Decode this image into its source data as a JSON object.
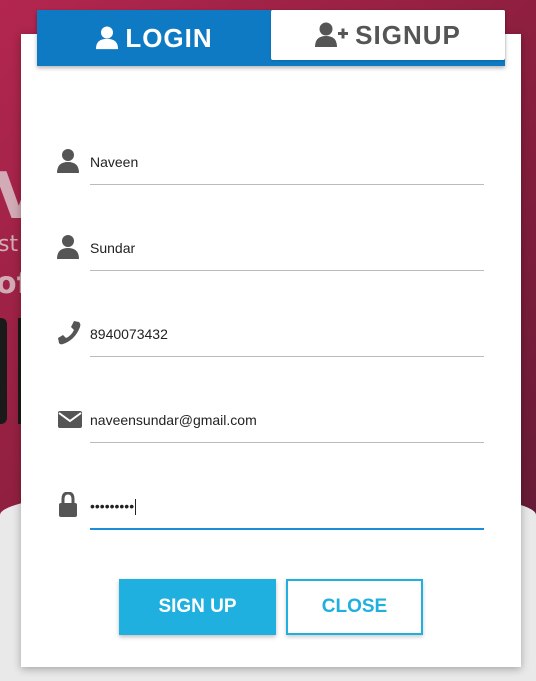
{
  "background": {
    "fragment_v": "V",
    "fragment_st": "st",
    "fragment_of": "of"
  },
  "tabs": {
    "login_label": "LOGIN",
    "signup_label": "SIGNUP"
  },
  "form": {
    "first_name": "Naveen",
    "last_name": "Sundar",
    "phone": "8940073432",
    "email": "naveensundar@gmail.com",
    "password_masked": "•••••••••"
  },
  "buttons": {
    "signup": "SIGN UP",
    "close": "CLOSE"
  },
  "colors": {
    "accent_blue": "#0e7ac4",
    "button_cyan": "#1fb0e0",
    "background": "#b3264f"
  },
  "icons": {
    "login_tab": "user-icon",
    "signup_tab": "user-plus-icon",
    "first_name": "user-icon",
    "last_name": "user-icon",
    "phone": "phone-icon",
    "email": "envelope-icon",
    "password": "lock-icon"
  }
}
